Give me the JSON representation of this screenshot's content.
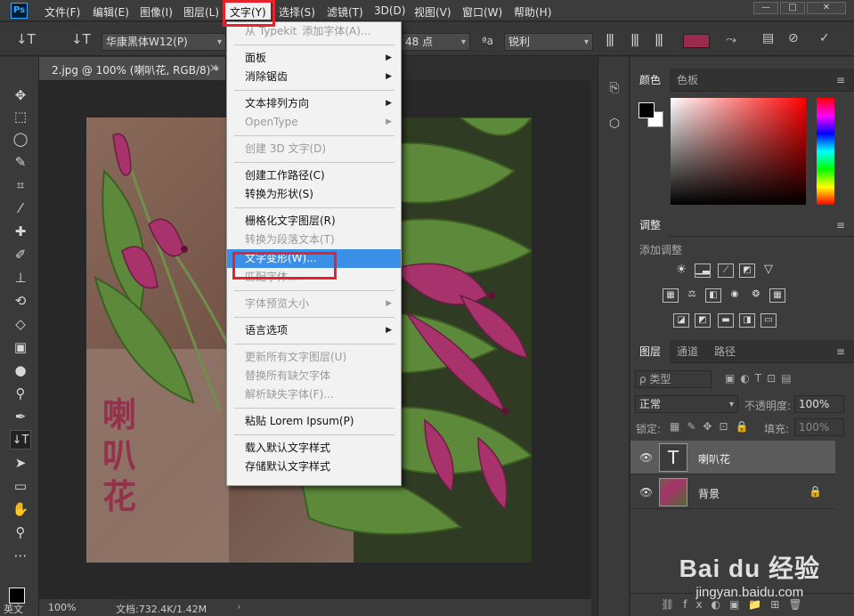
{
  "menubar": {
    "items": [
      "文件(F)",
      "编辑(E)",
      "图像(I)",
      "图层(L)",
      "文字(Y)",
      "选择(S)",
      "滤镜(T)",
      "3D(D)",
      "视图(V)",
      "窗口(W)",
      "帮助(H)"
    ],
    "active_index": 4,
    "logo": "Ps",
    "win_buttons": [
      "—",
      "□",
      "✕"
    ]
  },
  "options": {
    "tool_icon": "↓T",
    "font_family": "华康黑体W12(P)",
    "size": "48 点",
    "aa_icon": "ªa",
    "antialias": "锐利",
    "color": "#9b2b4d"
  },
  "document": {
    "tab_title": "2.jpg @ 100% (喇叭花, RGB/8) *",
    "close_icon": "×",
    "overlay_text": [
      "喇",
      "叭",
      "花"
    ],
    "zoom": "100%",
    "doc_size": "文档:732.4K/1.42M",
    "status_arrow": "›",
    "lang": "英文"
  },
  "dropdown": {
    "items": [
      {
        "label": "添加字体(A)...",
        "type": "item",
        "disabled": true,
        "prefix": "从 Typekit"
      },
      {
        "type": "sep"
      },
      {
        "label": "面板",
        "type": "item",
        "submenu": true
      },
      {
        "label": "消除锯齿",
        "type": "item",
        "submenu": true
      },
      {
        "type": "sep"
      },
      {
        "label": "文本排列方向",
        "type": "item",
        "submenu": true
      },
      {
        "label": "OpenType",
        "type": "item",
        "submenu": true,
        "disabled": true
      },
      {
        "type": "sep"
      },
      {
        "label": "创建 3D 文字(D)",
        "type": "item",
        "disabled": true
      },
      {
        "type": "sep"
      },
      {
        "label": "创建工作路径(C)",
        "type": "item"
      },
      {
        "label": "转换为形状(S)",
        "type": "item"
      },
      {
        "type": "sep"
      },
      {
        "label": "栅格化文字图层(R)",
        "type": "item"
      },
      {
        "label": "转换为段落文本(T)",
        "type": "item",
        "disabled": true
      },
      {
        "label": "文字变形(W)...",
        "type": "item",
        "highlighted": true
      },
      {
        "label": "匹配字体...",
        "type": "item",
        "disabled": true
      },
      {
        "type": "sep"
      },
      {
        "label": "字体预览大小",
        "type": "item",
        "submenu": true,
        "disabled": true
      },
      {
        "type": "sep"
      },
      {
        "label": "语言选项",
        "type": "item",
        "submenu": true
      },
      {
        "type": "sep"
      },
      {
        "label": "更新所有文字图层(U)",
        "type": "item",
        "disabled": true
      },
      {
        "label": "替换所有缺欠字体",
        "type": "item",
        "disabled": true
      },
      {
        "label": "解析缺失字体(F)...",
        "type": "item",
        "disabled": true
      },
      {
        "type": "sep"
      },
      {
        "label": "粘贴 Lorem Ipsum(P)",
        "type": "item"
      },
      {
        "type": "sep"
      },
      {
        "label": "载入默认文字样式",
        "type": "item"
      },
      {
        "label": "存储默认文字样式",
        "type": "item"
      }
    ]
  },
  "panels": {
    "color_tabs": [
      "颜色",
      "色板"
    ],
    "adjust_title": "调整",
    "adjust_hint": "添加调整",
    "layers_tabs": [
      "图层",
      "通道",
      "路径"
    ],
    "kind_label": "ρ 类型",
    "blend_mode": "正常",
    "opacity_label": "不透明度:",
    "opacity": "100%",
    "lock_label": "锁定:",
    "fill_label": "填充:",
    "fill": "100%",
    "layers": [
      {
        "name": "喇叭花",
        "type": "text",
        "thumb": "T"
      },
      {
        "name": "背景",
        "type": "image"
      }
    ],
    "menu_icon": "≡"
  },
  "watermark": {
    "line1": "Bai du 经验",
    "line2": "jingyan.baidu.com"
  }
}
